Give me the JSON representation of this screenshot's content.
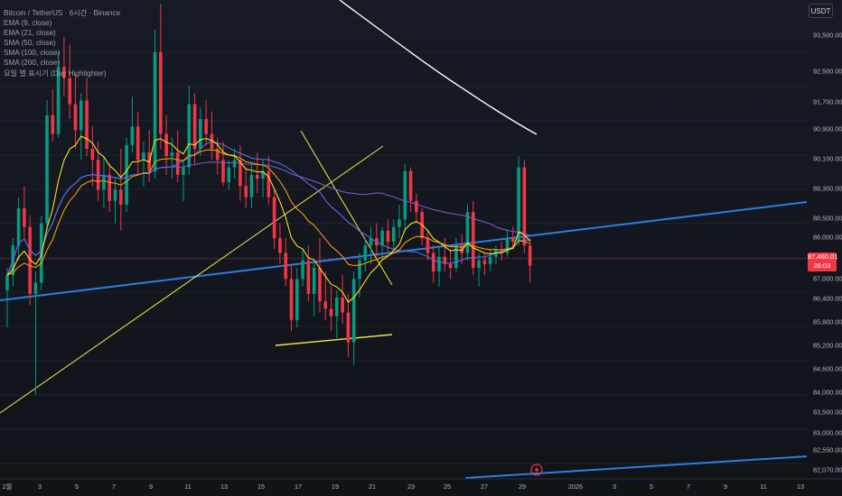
{
  "legend": {
    "symbol": "Bitcoin / TetherUS · 6시간 · Binance",
    "indicators": [
      "EMA (9, close)",
      "EMA (21, close)",
      "SMA (50, close)",
      "SMA (100, close)",
      "SMA (200, close)",
      "요일 별 표시기 (Day Highlighter)"
    ]
  },
  "axis_unit": "USDT",
  "last_price": "87,460.01",
  "countdown": "26:03",
  "colors": {
    "up": "#089981",
    "down": "#f23645",
    "ema9": "#f7e11b",
    "ema21": "#f39c12",
    "sma50": "#5b6fe0",
    "sma100": "#7e57c2",
    "sma200": "#ffffff",
    "trend": "#2a7fe5",
    "drawn": "#f4e84a"
  },
  "chart_data": {
    "type": "candlestick",
    "symbol": "Bitcoin / TetherUS",
    "interval": "6시간",
    "exchange": "Binance",
    "ylim": [
      81800,
      94600
    ],
    "y_ticks": [
      "93,500.00",
      "92,500.00",
      "91,700.00",
      "90,900.00",
      "90,100.00",
      "89,300.00",
      "88,500.00",
      "88,000.00",
      "87,460.01",
      "87,000.00",
      "86,400.00",
      "85,800.00",
      "85,200.00",
      "84,600.00",
      "84,000.00",
      "83,500.00",
      "83,000.00",
      "82,550.00",
      "82,070.00"
    ],
    "x_ticks": [
      "2월",
      "3",
      "5",
      "7",
      "9",
      "11",
      "13",
      "15",
      "17",
      "19",
      "21",
      "23",
      "25",
      "27",
      "29",
      "2026",
      "3",
      "5",
      "7",
      "9",
      "11",
      "13"
    ],
    "candles": [
      [
        86800,
        87400,
        85800,
        87200
      ],
      [
        87200,
        88200,
        86900,
        88000
      ],
      [
        88000,
        89300,
        87600,
        89000
      ],
      [
        89000,
        89600,
        88200,
        88500
      ],
      [
        88500,
        88800,
        86400,
        86700
      ],
      [
        86700,
        87300,
        84000,
        87000
      ],
      [
        87000,
        88800,
        86800,
        88600
      ],
      [
        88600,
        91900,
        88400,
        91500
      ],
      [
        91500,
        92200,
        90800,
        91000
      ],
      [
        91000,
        93200,
        90900,
        92800
      ],
      [
        92800,
        93600,
        92000,
        92500
      ],
      [
        92500,
        93400,
        91400,
        91800
      ],
      [
        91800,
        92600,
        90600,
        91100
      ],
      [
        91100,
        92100,
        90300,
        91900
      ],
      [
        91900,
        92500,
        90400,
        90600
      ],
      [
        90600,
        91200,
        89600,
        90300
      ],
      [
        90300,
        90800,
        89200,
        89500
      ],
      [
        89500,
        90400,
        89000,
        89900
      ],
      [
        89900,
        90200,
        88900,
        89200
      ],
      [
        89200,
        89800,
        88600,
        89500
      ],
      [
        89500,
        90600,
        88400,
        89100
      ],
      [
        89100,
        90900,
        88900,
        90700
      ],
      [
        90700,
        92000,
        90500,
        91200
      ],
      [
        91200,
        91600,
        89900,
        90300
      ],
      [
        90300,
        90800,
        89600,
        90500
      ],
      [
        90500,
        91100,
        89700,
        90000
      ],
      [
        90000,
        93800,
        89800,
        93200
      ],
      [
        93200,
        94500,
        90600,
        91000
      ],
      [
        91000,
        91500,
        89900,
        90400
      ],
      [
        90400,
        90900,
        89800,
        90500
      ],
      [
        90500,
        91100,
        89700,
        89900
      ],
      [
        89900,
        90300,
        89200,
        90100
      ],
      [
        90100,
        92300,
        89900,
        91800
      ],
      [
        91800,
        92100,
        90200,
        90600
      ],
      [
        90600,
        91700,
        90400,
        91400
      ],
      [
        91400,
        91900,
        90700,
        91000
      ],
      [
        91000,
        91600,
        90300,
        90600
      ],
      [
        90600,
        90900,
        89900,
        90300
      ],
      [
        90300,
        90800,
        89600,
        89700
      ],
      [
        89700,
        90300,
        89500,
        90100
      ],
      [
        90100,
        90600,
        89800,
        90300
      ],
      [
        90300,
        90700,
        89200,
        89600
      ],
      [
        89600,
        90100,
        89000,
        89300
      ],
      [
        89300,
        90200,
        89000,
        89900
      ],
      [
        89900,
        90500,
        89400,
        89800
      ],
      [
        89800,
        90300,
        89300,
        90000
      ],
      [
        90000,
        90400,
        89100,
        89300
      ],
      [
        89300,
        89500,
        87900,
        88200
      ],
      [
        88200,
        88600,
        87500,
        87800
      ],
      [
        87800,
        88200,
        86900,
        87100
      ],
      [
        87100,
        87500,
        85700,
        86000
      ],
      [
        86000,
        87400,
        85800,
        87100
      ],
      [
        87100,
        87900,
        86900,
        87600
      ],
      [
        87600,
        88000,
        86500,
        86700
      ],
      [
        86700,
        87600,
        86100,
        87400
      ],
      [
        87400,
        88200,
        86200,
        86500
      ],
      [
        86500,
        87300,
        86000,
        86300
      ],
      [
        86300,
        86900,
        85700,
        86100
      ],
      [
        86100,
        86800,
        85500,
        86600
      ],
      [
        86600,
        87200,
        85900,
        86200
      ],
      [
        86200,
        86700,
        85000,
        85400
      ],
      [
        85400,
        87300,
        84800,
        87100
      ],
      [
        87100,
        87800,
        86600,
        87600
      ],
      [
        87600,
        88200,
        87300,
        88000
      ],
      [
        88000,
        88500,
        87500,
        88200
      ],
      [
        88200,
        88600,
        87700,
        88000
      ],
      [
        88000,
        88500,
        87600,
        88400
      ],
      [
        88400,
        88700,
        87800,
        88100
      ],
      [
        88100,
        88700,
        87900,
        88500
      ],
      [
        88500,
        89100,
        88200,
        88700
      ],
      [
        88700,
        90200,
        88400,
        90000
      ],
      [
        90000,
        90100,
        88900,
        89200
      ],
      [
        89200,
        89400,
        88600,
        88900
      ],
      [
        88900,
        89000,
        88000,
        88200
      ],
      [
        88200,
        88400,
        87600,
        87800
      ],
      [
        87800,
        88000,
        87000,
        87300
      ],
      [
        87300,
        88000,
        86900,
        87700
      ],
      [
        87700,
        88200,
        87300,
        87500
      ],
      [
        87500,
        87900,
        87100,
        87400
      ],
      [
        87400,
        88200,
        87300,
        88000
      ],
      [
        88000,
        88300,
        87500,
        87800
      ],
      [
        87800,
        89100,
        87600,
        88900
      ],
      [
        88900,
        89200,
        87200,
        87400
      ],
      [
        87400,
        87800,
        86900,
        87600
      ],
      [
        87600,
        87800,
        87200,
        87500
      ],
      [
        87500,
        87900,
        87300,
        87700
      ],
      [
        87700,
        88000,
        87500,
        87900
      ],
      [
        87900,
        88100,
        87600,
        87800
      ],
      [
        87800,
        88400,
        87700,
        88200
      ],
      [
        88200,
        88500,
        87900,
        88100
      ],
      [
        88100,
        90400,
        88000,
        90100
      ],
      [
        90100,
        90300,
        87800,
        88000
      ],
      [
        88000,
        88200,
        87000,
        87460
      ]
    ]
  }
}
